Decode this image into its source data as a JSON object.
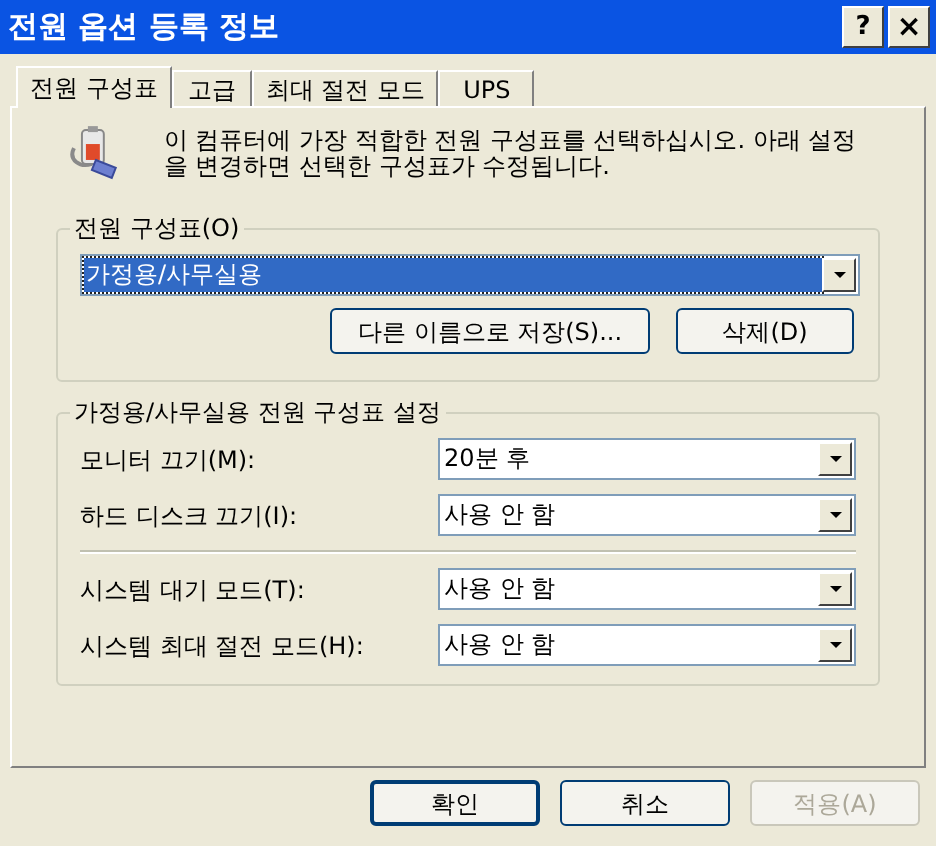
{
  "window": {
    "title": "전원 옵션 등록 정보",
    "help_button": "?",
    "close_button": "×"
  },
  "tabs": [
    {
      "label": "전원 구성표",
      "selected": true
    },
    {
      "label": "고급",
      "selected": false
    },
    {
      "label": "최대 절전 모드",
      "selected": false
    },
    {
      "label": "UPS",
      "selected": false
    }
  ],
  "description": "이 컴퓨터에 가장 적합한 전원 구성표를 선택하십시오. 아래 설정을 변경하면 선택한 구성표가 수정됩니다.",
  "scheme_group": {
    "label": "전원 구성표(O)",
    "value": "가정용/사무실용",
    "highlighted": true,
    "buttons": [
      {
        "label": "다른 이름으로 저장(S)..."
      },
      {
        "label": "삭제(D)"
      }
    ]
  },
  "settings_group": {
    "label": "가정용/사무실용 전원 구성표 설정",
    "sections": [
      [
        {
          "label": "모니터 끄기(M):",
          "value": "20분 후"
        },
        {
          "label": "하드 디스크 끄기(I):",
          "value": "사용 안 함"
        }
      ],
      [
        {
          "label": "시스템 대기 모드(T):",
          "value": "사용 안 함"
        },
        {
          "label": "시스템 최대 절전 모드(H):",
          "value": "사용 안 함"
        }
      ]
    ]
  },
  "buttons": [
    {
      "label": "확인",
      "default": true,
      "disabled": false
    },
    {
      "label": "취소",
      "default": false,
      "disabled": false
    },
    {
      "label": "적용(A)",
      "default": false,
      "disabled": true
    }
  ]
}
